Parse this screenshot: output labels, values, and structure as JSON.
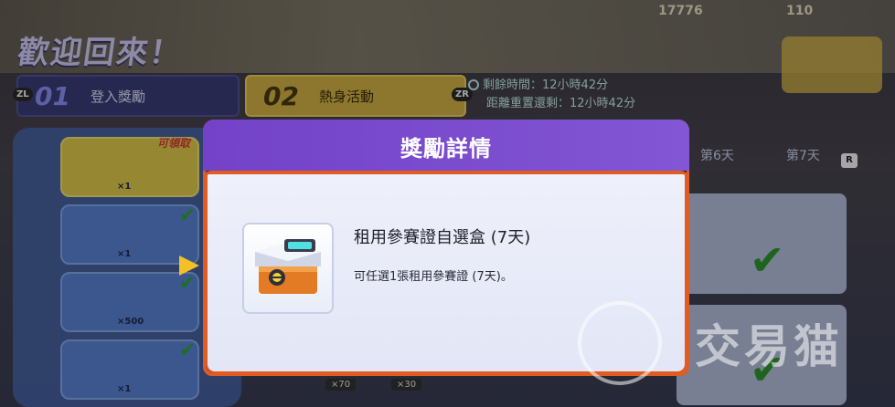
{
  "background": {
    "welcome_text": "歡迎回來！",
    "currency_1": "17776",
    "currency_2": "110",
    "tabs": [
      {
        "button_tag": "ZL",
        "number": "01",
        "label": "登入獎勵"
      },
      {
        "button_tag": "ZR",
        "number": "02",
        "label": "熱身活動"
      }
    ],
    "timers": {
      "remaining": "剩餘時間：12小時42分",
      "reset": "距離重置還剩：12小時42分"
    },
    "claimable_tag": "可領取",
    "days": [
      "第6天",
      "第7天"
    ],
    "r_button": "R",
    "reward_quantities": [
      "×1",
      "×1",
      "×500",
      "×1"
    ],
    "bottom_quantities": [
      "×70",
      "×30"
    ]
  },
  "watermark": {
    "text": "交易猫"
  },
  "modal": {
    "title": "獎勵詳情",
    "item_name": "租用參賽證自選盒 (7天)",
    "item_description": "可任選1張租用參賽證 (7天)。"
  },
  "colors": {
    "modal_header": "#7342c8",
    "modal_border": "#e15b22",
    "pointer": "#f2c126",
    "check": "#2e9a2e"
  }
}
